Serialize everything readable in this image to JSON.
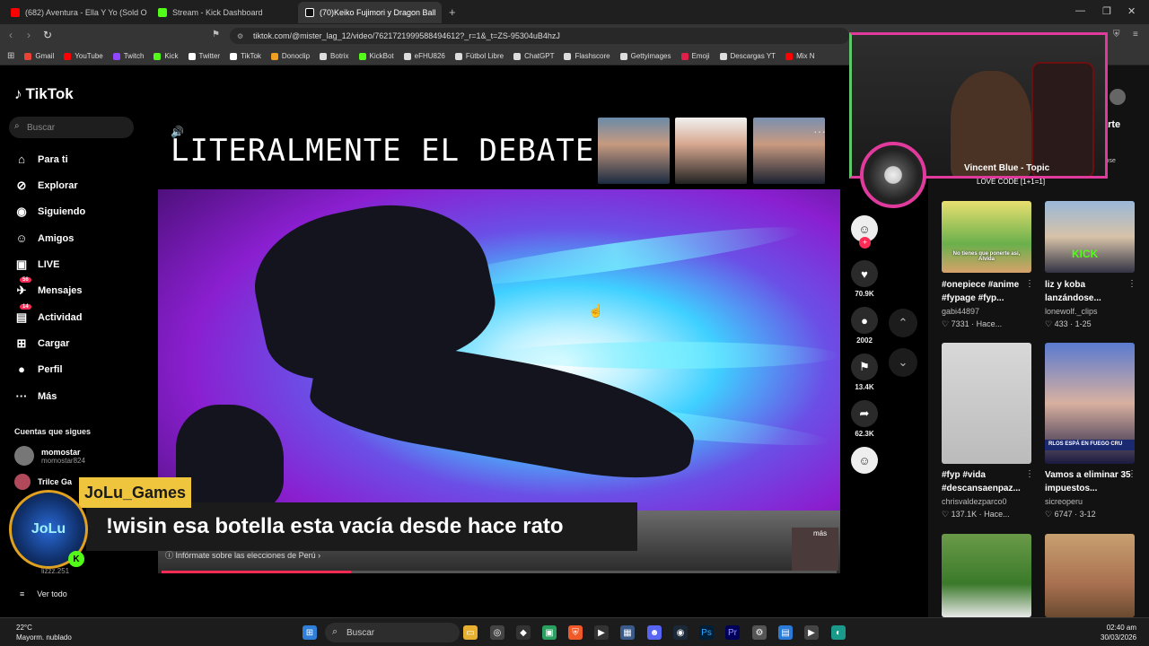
{
  "tabs": [
    {
      "title": "(682) Aventura - Ella Y Yo (Sold Out",
      "color": "#ff0000"
    },
    {
      "title": "Stream - Kick Dashboard",
      "color": "#53fc18"
    },
    {
      "title": "(70)Keiko Fujimori y Dragon Ball",
      "color": "#ffffff"
    }
  ],
  "url": "tiktok.com/@mister_lag_12/video/7621721999588494612?_r=1&_t=ZS-95304uB4hzJ",
  "bookmarks": [
    {
      "label": "Gmail",
      "color": "#ea4335"
    },
    {
      "label": "YouTube",
      "color": "#ff0000"
    },
    {
      "label": "Twitch",
      "color": "#9146ff"
    },
    {
      "label": "Kick",
      "color": "#53fc18"
    },
    {
      "label": "Twitter",
      "color": "#ffffff"
    },
    {
      "label": "TikTok",
      "color": "#ffffff"
    },
    {
      "label": "Donoclip",
      "color": "#f0a020"
    },
    {
      "label": "Botrix",
      "color": "#dddddd"
    },
    {
      "label": "KickBot",
      "color": "#53fc18"
    },
    {
      "label": "eFHU826",
      "color": "#dddddd"
    },
    {
      "label": "Fútbol Libre",
      "color": "#dddddd"
    },
    {
      "label": "ChatGPT",
      "color": "#dddddd"
    },
    {
      "label": "Flashscore",
      "color": "#dddddd"
    },
    {
      "label": "Gettyimages",
      "color": "#dddddd"
    },
    {
      "label": "Emoji",
      "color": "#e0204a"
    },
    {
      "label": "Descargas YT",
      "color": "#dddddd"
    },
    {
      "label": "Mix N",
      "color": "#ff0000"
    }
  ],
  "sidebar": {
    "logo": "TikTok",
    "search_placeholder": "Buscar",
    "nav": [
      {
        "label": "Para ti",
        "icon": "⌂"
      },
      {
        "label": "Explorar",
        "icon": "⊘"
      },
      {
        "label": "Siguiendo",
        "icon": "◉"
      },
      {
        "label": "Amigos",
        "icon": "☺"
      },
      {
        "label": "LIVE",
        "icon": "▣"
      },
      {
        "label": "Mensajes",
        "icon": "✈",
        "badge": "56"
      },
      {
        "label": "Actividad",
        "icon": "▤",
        "badge": "14"
      },
      {
        "label": "Cargar",
        "icon": "⊞"
      },
      {
        "label": "Perfil",
        "icon": "●"
      },
      {
        "label": "Más",
        "icon": "···"
      }
    ],
    "following_title": "Cuentas que sigues",
    "following": [
      {
        "name": "momostar",
        "handle": "momostar824"
      },
      {
        "name": "Trilce Ga",
        "handle": ""
      }
    ],
    "partial_handle": "lizzz.251",
    "see_all": "Ver todo"
  },
  "video": {
    "caption": "LITERALMENTE EL DEBATE DE:",
    "info_link": "Infórmate sobre las elecciones de Perú",
    "more": "más",
    "progress": 0.28
  },
  "actions": {
    "likes": "70.9K",
    "comments": "2002",
    "saves": "13.4K",
    "shares": "62.3K"
  },
  "music": {
    "title": "Vincent Blue - Topic",
    "subtitle": "LOVE CODE [1+1=1]"
  },
  "right_cards": [
    {
      "desc": "#onepiece #anime #fypage #fyp...",
      "user": "gabi44897",
      "likes": "7331",
      "when": "Hace...",
      "thumb_text": "No tienes que ponerte así, Alvida"
    },
    {
      "desc": "liz y koba lanzándose...",
      "user": "lonewolf._clips",
      "likes": "433",
      "when": "1-25",
      "thumb_text": "KICK"
    },
    {
      "desc": "#fyp #vida #descansaenpaz...",
      "user": "chrisvaldezparco0",
      "likes": "137.1K",
      "when": "Hace...",
      "thumb_text": ""
    },
    {
      "desc": "Vamos a eliminar 35 impuestos...",
      "user": "sicreoperu",
      "likes": "6747",
      "when": "3-12",
      "thumb_text": "RLOS ESPÁ EN FUEGO CRU"
    }
  ],
  "partial_header": "arte",
  "partial_close": "lose",
  "chat": {
    "username": "JoLu_Games",
    "message": "!wisin esa botella esta vacía desde hace rato",
    "logo_text": "JoLu"
  },
  "taskbar": {
    "temp": "22°C",
    "weather": "Mayorm. nublado",
    "search": "Buscar",
    "time": "02:40 am",
    "date": "30/03/2026"
  }
}
